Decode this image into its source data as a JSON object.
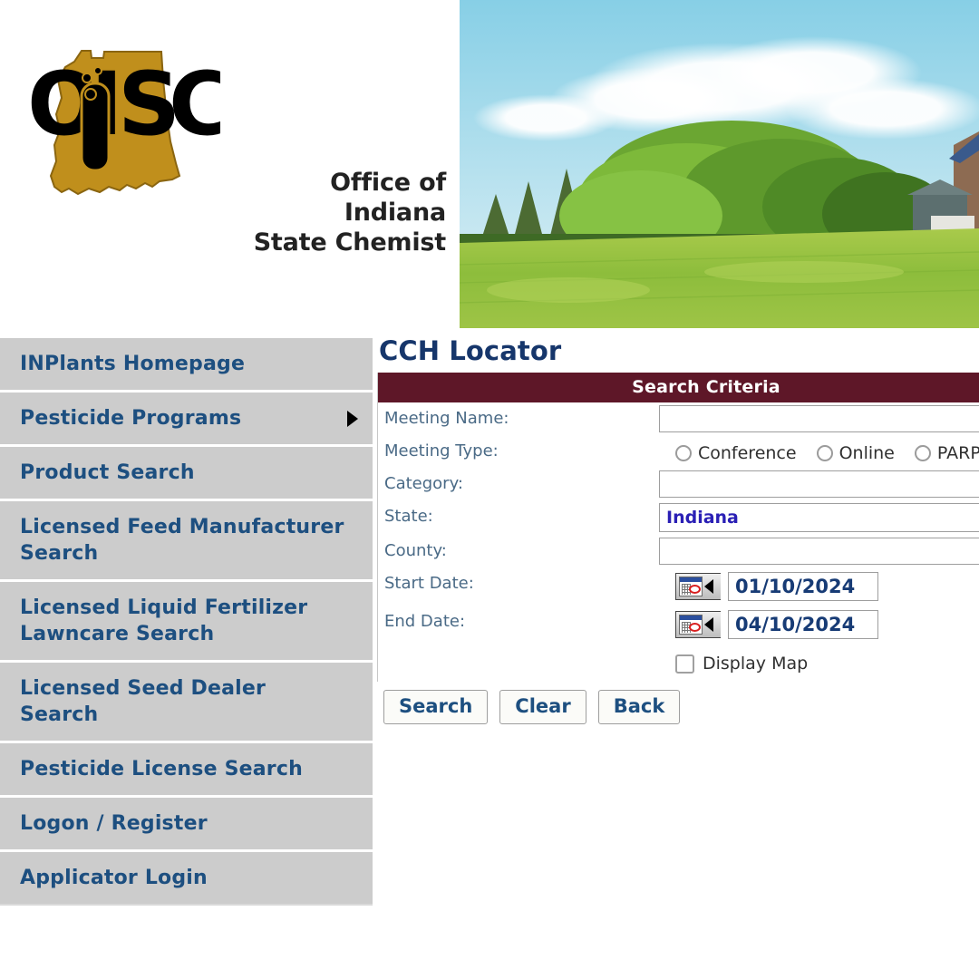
{
  "header": {
    "logo": {
      "acronym": "OISC",
      "wordmark_line1": "Office of Indiana",
      "wordmark_line2": "State Chemist",
      "state_shape": "indiana",
      "colors": {
        "state_gold": "#c08f1c",
        "acronym_black": "#000000",
        "wordmark": "#222222"
      }
    },
    "banner": {
      "alt": "Rural Indiana farm landscape with trees, green field and barn",
      "colors": {
        "sky": "#a7dced",
        "cloud": "#ffffff",
        "tree": "#5f9a2e",
        "field": "#8fc13e",
        "barn": "#6c7f7f"
      }
    }
  },
  "sidebar": {
    "items": [
      {
        "label": "INPlants Homepage",
        "has_submenu": false
      },
      {
        "label": "Pesticide Programs",
        "has_submenu": true
      },
      {
        "label": "Product Search",
        "has_submenu": false
      },
      {
        "label": "Licensed Feed Manufacturer Search",
        "has_submenu": false
      },
      {
        "label": "Licensed Liquid Fertilizer Lawncare Search",
        "has_submenu": false
      },
      {
        "label": "Licensed Seed Dealer Search",
        "has_submenu": false
      },
      {
        "label": "Pesticide License Search",
        "has_submenu": false
      },
      {
        "label": "Logon / Register",
        "has_submenu": false
      },
      {
        "label": "Applicator Login",
        "has_submenu": false
      }
    ],
    "colors": {
      "background": "#cccccc",
      "link": "#1d4f80",
      "divider": "#ffffff"
    }
  },
  "main": {
    "page_title": "CCH Locator",
    "criteria_bar_label": "Search Criteria",
    "criteria_bar_color": "#5e1728",
    "fields": {
      "meeting_name": {
        "label": "Meeting Name:",
        "value": "",
        "placeholder": ""
      },
      "meeting_type": {
        "label": "Meeting Type:",
        "options": [
          {
            "label": "Conference",
            "selected": false
          },
          {
            "label": "Online",
            "selected": false
          },
          {
            "label": "PARP",
            "selected": false
          }
        ]
      },
      "category": {
        "label": "Category:",
        "value": "",
        "placeholder": ""
      },
      "state": {
        "label": "State:",
        "value": "Indiana"
      },
      "county": {
        "label": "County:",
        "value": "",
        "placeholder": ""
      },
      "start_date": {
        "label": "Start Date:",
        "value": "01/10/2024",
        "picker_icon": "calendar-icon"
      },
      "end_date": {
        "label": "End Date:",
        "value": "04/10/2024",
        "picker_icon": "calendar-icon"
      },
      "display_map": {
        "label": "Display Map",
        "checked": false
      }
    },
    "buttons": [
      {
        "label": "Search",
        "name": "search-button"
      },
      {
        "label": "Clear",
        "name": "clear-button"
      },
      {
        "label": "Back",
        "name": "back-button"
      }
    ]
  }
}
